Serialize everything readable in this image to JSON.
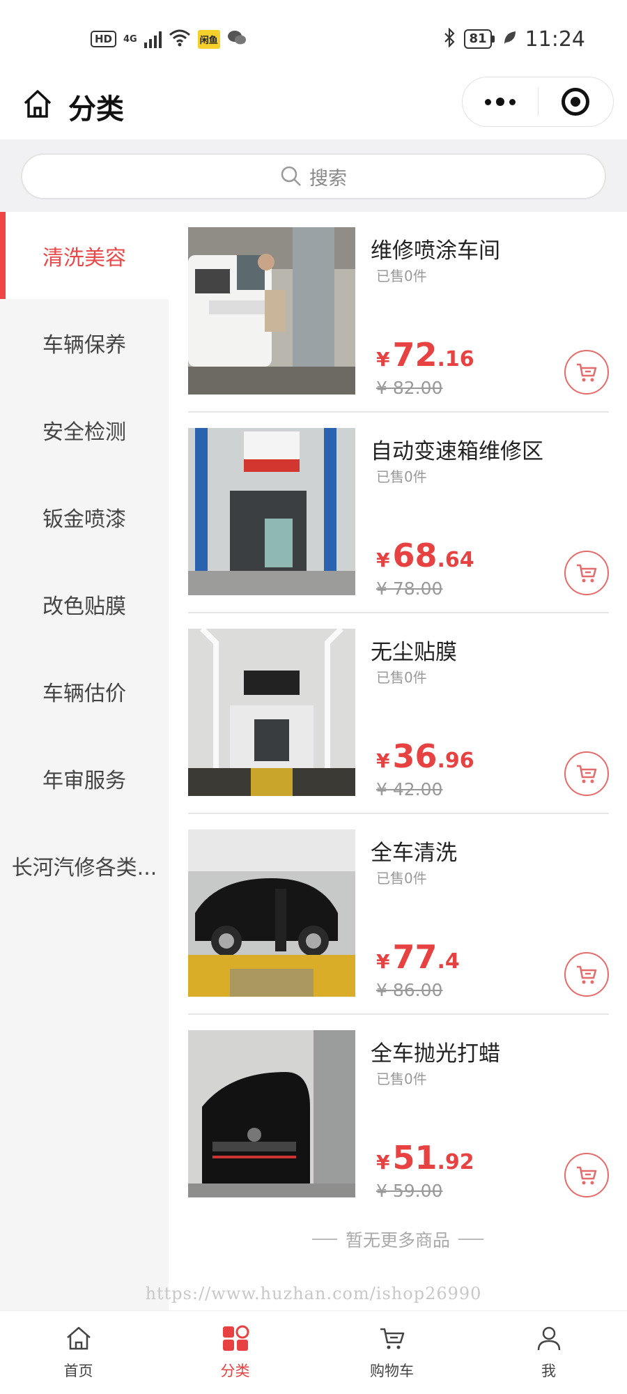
{
  "status_bar": {
    "hd": "HD",
    "network": "4G",
    "app_badge": "闲鱼",
    "battery": "81",
    "time": "11:24"
  },
  "nav": {
    "title": "分类"
  },
  "search": {
    "placeholder": "搜索"
  },
  "sidebar": {
    "items": [
      {
        "label": "清洗美容"
      },
      {
        "label": "车辆保养"
      },
      {
        "label": "安全检测"
      },
      {
        "label": "钣金喷漆"
      },
      {
        "label": "改色贴膜"
      },
      {
        "label": "车辆估价"
      },
      {
        "label": "年审服务"
      },
      {
        "label": "长河汽修各类..."
      }
    ]
  },
  "products": [
    {
      "name": "维修喷涂车间",
      "sold": "已售0件",
      "currency": "¥",
      "price_int": "72",
      "price_dec": ".16",
      "old_price": "¥ 82.00"
    },
    {
      "name": "自动变速箱维修区",
      "sold": "已售0件",
      "currency": "¥",
      "price_int": "68",
      "price_dec": ".64",
      "old_price": "¥ 78.00"
    },
    {
      "name": "无尘贴膜",
      "sold": "已售0件",
      "currency": "¥",
      "price_int": "36",
      "price_dec": ".96",
      "old_price": "¥ 42.00"
    },
    {
      "name": "全车清洗",
      "sold": "已售0件",
      "currency": "¥",
      "price_int": "77",
      "price_dec": ".4",
      "old_price": "¥ 86.00"
    },
    {
      "name": "全车抛光打蜡",
      "sold": "已售0件",
      "currency": "¥",
      "price_int": "51",
      "price_dec": ".92",
      "old_price": "¥ 59.00"
    }
  ],
  "list_footer": {
    "no_more": "暂无更多商品"
  },
  "watermark": "https://www.huzhan.com/ishop26990",
  "tabbar": {
    "items": [
      {
        "label": "首页",
        "icon": "home-icon"
      },
      {
        "label": "分类",
        "icon": "category-icon"
      },
      {
        "label": "购物车",
        "icon": "cart-icon"
      },
      {
        "label": "我",
        "icon": "user-icon"
      }
    ]
  },
  "colors": {
    "accent": "#e84141",
    "sidebar_bg": "#f5f5f5"
  }
}
